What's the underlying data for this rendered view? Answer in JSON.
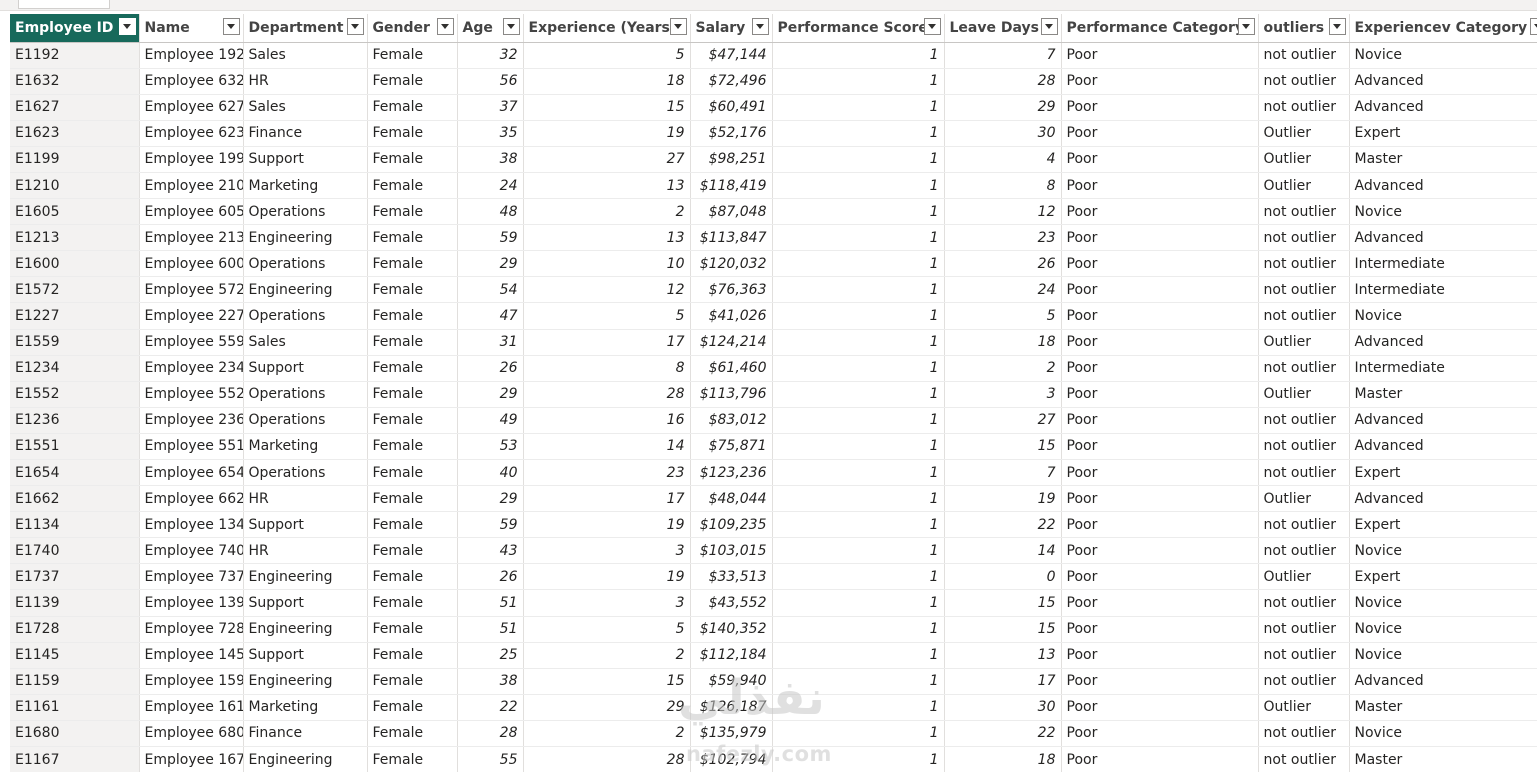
{
  "table": {
    "columns": [
      {
        "key": "id",
        "label": "Employee ID",
        "active": true
      },
      {
        "key": "name",
        "label": "Name"
      },
      {
        "key": "department",
        "label": "Department"
      },
      {
        "key": "gender",
        "label": "Gender"
      },
      {
        "key": "age",
        "label": "Age"
      },
      {
        "key": "experience",
        "label": "Experience (Years)"
      },
      {
        "key": "salary",
        "label": "Salary"
      },
      {
        "key": "performance_score",
        "label": "Performance Score"
      },
      {
        "key": "leave_days",
        "label": "Leave Days"
      },
      {
        "key": "performance_category",
        "label": "Performance Category"
      },
      {
        "key": "outliers",
        "label": "outliers"
      },
      {
        "key": "experience_category",
        "label": "Experiencev Category"
      }
    ],
    "rows": [
      [
        "E1192",
        "Employee 192",
        "Sales",
        "Female",
        "32",
        "5",
        "$47,144",
        "1",
        "7",
        "Poor",
        "not outlier",
        "Novice"
      ],
      [
        "E1632",
        "Employee 632",
        "HR",
        "Female",
        "56",
        "18",
        "$72,496",
        "1",
        "28",
        "Poor",
        "not outlier",
        "Advanced"
      ],
      [
        "E1627",
        "Employee 627",
        "Sales",
        "Female",
        "37",
        "15",
        "$60,491",
        "1",
        "29",
        "Poor",
        "not outlier",
        "Advanced"
      ],
      [
        "E1623",
        "Employee 623",
        "Finance",
        "Female",
        "35",
        "19",
        "$52,176",
        "1",
        "30",
        "Poor",
        "Outlier",
        "Expert"
      ],
      [
        "E1199",
        "Employee 199",
        "Support",
        "Female",
        "38",
        "27",
        "$98,251",
        "1",
        "4",
        "Poor",
        "Outlier",
        "Master"
      ],
      [
        "E1210",
        "Employee 210",
        "Marketing",
        "Female",
        "24",
        "13",
        "$118,419",
        "1",
        "8",
        "Poor",
        "Outlier",
        "Advanced"
      ],
      [
        "E1605",
        "Employee 605",
        "Operations",
        "Female",
        "48",
        "2",
        "$87,048",
        "1",
        "12",
        "Poor",
        "not outlier",
        "Novice"
      ],
      [
        "E1213",
        "Employee 213",
        "Engineering",
        "Female",
        "59",
        "13",
        "$113,847",
        "1",
        "23",
        "Poor",
        "not outlier",
        "Advanced"
      ],
      [
        "E1600",
        "Employee 600",
        "Operations",
        "Female",
        "29",
        "10",
        "$120,032",
        "1",
        "26",
        "Poor",
        "not outlier",
        "Intermediate"
      ],
      [
        "E1572",
        "Employee 572",
        "Engineering",
        "Female",
        "54",
        "12",
        "$76,363",
        "1",
        "24",
        "Poor",
        "not outlier",
        "Intermediate"
      ],
      [
        "E1227",
        "Employee 227",
        "Operations",
        "Female",
        "47",
        "5",
        "$41,026",
        "1",
        "5",
        "Poor",
        "not outlier",
        "Novice"
      ],
      [
        "E1559",
        "Employee 559",
        "Sales",
        "Female",
        "31",
        "17",
        "$124,214",
        "1",
        "18",
        "Poor",
        "Outlier",
        "Advanced"
      ],
      [
        "E1234",
        "Employee 234",
        "Support",
        "Female",
        "26",
        "8",
        "$61,460",
        "1",
        "2",
        "Poor",
        "not outlier",
        "Intermediate"
      ],
      [
        "E1552",
        "Employee 552",
        "Operations",
        "Female",
        "29",
        "28",
        "$113,796",
        "1",
        "3",
        "Poor",
        "Outlier",
        "Master"
      ],
      [
        "E1236",
        "Employee 236",
        "Operations",
        "Female",
        "49",
        "16",
        "$83,012",
        "1",
        "27",
        "Poor",
        "not outlier",
        "Advanced"
      ],
      [
        "E1551",
        "Employee 551",
        "Marketing",
        "Female",
        "53",
        "14",
        "$75,871",
        "1",
        "15",
        "Poor",
        "not outlier",
        "Advanced"
      ],
      [
        "E1654",
        "Employee 654",
        "Operations",
        "Female",
        "40",
        "23",
        "$123,236",
        "1",
        "7",
        "Poor",
        "not outlier",
        "Expert"
      ],
      [
        "E1662",
        "Employee 662",
        "HR",
        "Female",
        "29",
        "17",
        "$48,044",
        "1",
        "19",
        "Poor",
        "Outlier",
        "Advanced"
      ],
      [
        "E1134",
        "Employee 134",
        "Support",
        "Female",
        "59",
        "19",
        "$109,235",
        "1",
        "22",
        "Poor",
        "not outlier",
        "Expert"
      ],
      [
        "E1740",
        "Employee 740",
        "HR",
        "Female",
        "43",
        "3",
        "$103,015",
        "1",
        "14",
        "Poor",
        "not outlier",
        "Novice"
      ],
      [
        "E1737",
        "Employee 737",
        "Engineering",
        "Female",
        "26",
        "19",
        "$33,513",
        "1",
        "0",
        "Poor",
        "Outlier",
        "Expert"
      ],
      [
        "E1139",
        "Employee 139",
        "Support",
        "Female",
        "51",
        "3",
        "$43,552",
        "1",
        "15",
        "Poor",
        "not outlier",
        "Novice"
      ],
      [
        "E1728",
        "Employee 728",
        "Engineering",
        "Female",
        "51",
        "5",
        "$140,352",
        "1",
        "15",
        "Poor",
        "not outlier",
        "Novice"
      ],
      [
        "E1145",
        "Employee 145",
        "Support",
        "Female",
        "25",
        "2",
        "$112,184",
        "1",
        "13",
        "Poor",
        "not outlier",
        "Novice"
      ],
      [
        "E1159",
        "Employee 159",
        "Engineering",
        "Female",
        "38",
        "15",
        "$59,940",
        "1",
        "17",
        "Poor",
        "not outlier",
        "Advanced"
      ],
      [
        "E1161",
        "Employee 161",
        "Marketing",
        "Female",
        "22",
        "29",
        "$126,187",
        "1",
        "30",
        "Poor",
        "Outlier",
        "Master"
      ],
      [
        "E1680",
        "Employee 680",
        "Finance",
        "Female",
        "28",
        "2",
        "$135,979",
        "1",
        "22",
        "Poor",
        "not outlier",
        "Novice"
      ],
      [
        "E1167",
        "Employee 167",
        "Engineering",
        "Female",
        "55",
        "28",
        "$102,794",
        "1",
        "18",
        "Poor",
        "not outlier",
        "Master"
      ]
    ]
  },
  "watermark": {
    "arabic": "نفذلي",
    "domain": "nafezly.com"
  },
  "colors": {
    "active_header": "#17695b",
    "id_column_bg": "#f3f2f1"
  }
}
